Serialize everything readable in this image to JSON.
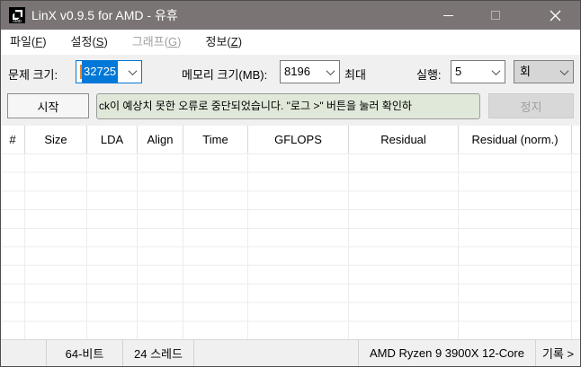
{
  "window": {
    "title": "LinX v0.9.5 for AMD - 유휴",
    "icons": {
      "app": "amd-logo-icon",
      "minimize": "minimize-icon",
      "maximize": "maximize-icon",
      "close": "close-icon"
    }
  },
  "menu": {
    "items": [
      {
        "pre": "파일(",
        "key": "F",
        "post": ")",
        "enabled": true
      },
      {
        "pre": "설정(",
        "key": "S",
        "post": ")",
        "enabled": true
      },
      {
        "pre": "그래프(",
        "key": "G",
        "post": ")",
        "enabled": false
      },
      {
        "pre": "정보(",
        "key": "Z",
        "post": ")",
        "enabled": true
      }
    ]
  },
  "settings": {
    "problem_size": {
      "label": "문제 크기:",
      "value": "32725"
    },
    "memory": {
      "label": "메모리 크기(MB):",
      "value": "8196"
    },
    "max_label": "최대",
    "runs": {
      "label": "실행:",
      "value": "5"
    },
    "unit": {
      "value": "회"
    }
  },
  "actions": {
    "start_label": "시작",
    "stop_label": "정지",
    "status_message": "ck이 예상치 못한 오류로 중단되었습니다. \"로그 >\" 버튼을 눌러 확인하"
  },
  "results_table": {
    "columns": [
      "#",
      "Size",
      "LDA",
      "Align",
      "Time",
      "GFLOPS",
      "Residual",
      "Residual (norm.)"
    ],
    "rows": []
  },
  "statusbar": {
    "bitness": "64-비트",
    "threads": "24 스레드",
    "cpu": "AMD Ryzen 9 3900X 12-Core",
    "history": "기록 >"
  },
  "colors": {
    "titlebar": "#7a7475",
    "accent": "#0078d7",
    "selection_bg": "#0078d7",
    "caret": "#e2872f",
    "status_box_bg": "#dfe8d9",
    "client_bg": "#f0f0f0"
  }
}
